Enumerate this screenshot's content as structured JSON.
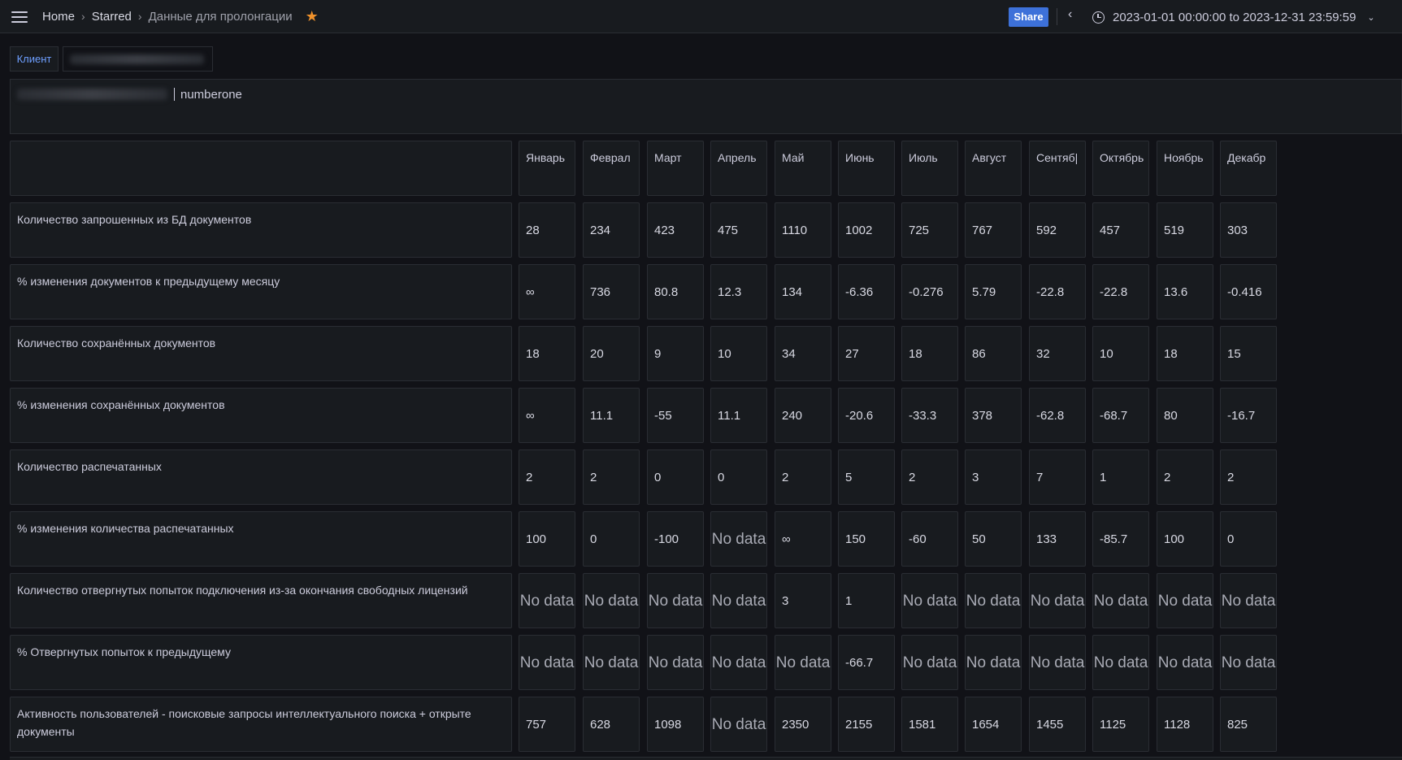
{
  "nav": {
    "home": "Home",
    "starred": "Starred",
    "dashboard_title": "Данные для пролонгации",
    "share": "Share",
    "time_range": "2023-01-01 00:00:00 to 2023-12-31 23:59:59"
  },
  "variable": {
    "label": "Клиент"
  },
  "text_panel": {
    "client_suffix": "numberone"
  },
  "months": [
    "Январь",
    "Феврал",
    "Март",
    "Апрель",
    "Май",
    "Июнь",
    "Июль",
    "Август",
    "Сентяб|",
    "Октябрь",
    "Ноябрь",
    "Декабр"
  ],
  "rows": [
    {
      "label": "Количество запрошенных из БД документов",
      "values": [
        "28",
        "234",
        "423",
        "475",
        "1110",
        "1002",
        "725",
        "767",
        "592",
        "457",
        "519",
        "303"
      ]
    },
    {
      "label": "% изменения документов к предыдущему месяцу",
      "values": [
        "∞",
        "736",
        "80.8",
        "12.3",
        "134",
        "-6.36",
        "-0.276",
        "5.79",
        "-22.8",
        "-22.8",
        "13.6",
        "-0.416"
      ]
    },
    {
      "label": "Количество сохранённых документов",
      "values": [
        "18",
        "20",
        "9",
        "10",
        "34",
        "27",
        "18",
        "86",
        "32",
        "10",
        "18",
        "15"
      ]
    },
    {
      "label": "% изменения сохранённых документов",
      "values": [
        "∞",
        "11.1",
        "-55",
        "11.1",
        "240",
        "-20.6",
        "-33.3",
        "378",
        "-62.8",
        "-68.7",
        "80",
        "-16.7"
      ]
    },
    {
      "label": "Количество распечатанных",
      "values": [
        "2",
        "2",
        "0",
        "0",
        "2",
        "5",
        "2",
        "3",
        "7",
        "1",
        "2",
        "2"
      ]
    },
    {
      "label": "% изменения количества распечатанных",
      "values": [
        "100",
        "0",
        "-100",
        "No data",
        "∞",
        "150",
        "-60",
        "50",
        "133",
        "-85.7",
        "100",
        "0"
      ]
    },
    {
      "label": "Количество отвергнутых попыток подключения из-за окончания свободных лицензий",
      "values": [
        "No data",
        "No data",
        "No data",
        "No data",
        "3",
        "1",
        "No data",
        "No data",
        "No data",
        "No data",
        "No data",
        "No data"
      ]
    },
    {
      "label": "% Отвергнутых попыток к предыдущему",
      "values": [
        "No data",
        "No data",
        "No data",
        "No data",
        "No data",
        "-66.7",
        "No data",
        "No data",
        "No data",
        "No data",
        "No data",
        "No data"
      ]
    },
    {
      "label": "Активность пользователей - поисковые запросы интеллектуального поиска + открыте документы",
      "values": [
        "757",
        "628",
        "1098",
        "No data",
        "2350",
        "2155",
        "1581",
        "1654",
        "1455",
        "1125",
        "1128",
        "825"
      ]
    }
  ]
}
